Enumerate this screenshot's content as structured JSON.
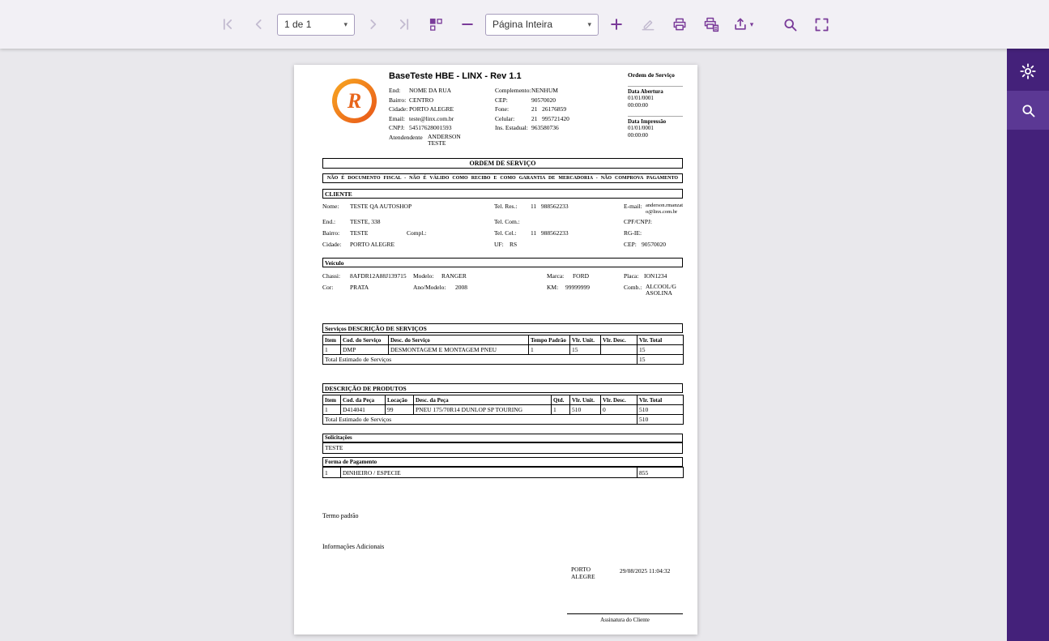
{
  "toolbar": {
    "page_select": "1 de 1",
    "zoom_select": "Página Inteira"
  },
  "icons": {
    "toolbar": [
      "first-page",
      "previous-page",
      "next-page",
      "last-page",
      "page-layout",
      "zoom-out",
      "zoom-in",
      "edit",
      "print",
      "print-setup",
      "export",
      "search",
      "fullscreen"
    ],
    "sidebar": [
      "settings",
      "search"
    ]
  },
  "doc": {
    "header": {
      "title": "BaseTeste HBE - LINX - Rev 1.1",
      "logo_letter": "R",
      "company": {
        "end_l": "End:",
        "end_v": "NOME DA RUA",
        "comp_l": "Complemento:",
        "comp_v": "NENHUM",
        "bairro_l": "Bairro:",
        "bairro_v": "CENTRO",
        "cep_l": "CEP:",
        "cep_v": "90570020",
        "cidade_l": "Cidade:",
        "cidade_v": "PORTO ALEGRE",
        "fone_l": "Fone:",
        "fone_v": "21   26176859",
        "email_l": "Email:",
        "email_v": "teste@linx.com.br",
        "cel_l": "Celular:",
        "cel_v": "21   995721420",
        "cnpj_l": "CNPJ:",
        "cnpj_v": "54517628001593",
        "ins_l": "Ins. Estadual:",
        "ins_v": "963580736",
        "atend_l": "Atendendente",
        "atend_v": "ANDERSON TESTE"
      },
      "order_label": "Ordem de Serviço",
      "abertura_l": "Data Abertura",
      "abertura_date": "01/01/0001",
      "abertura_time": "00:00:00",
      "impressao_l": "Data Impressão",
      "impressao_date": "01/01/0001",
      "impressao_time": "00:00:00"
    },
    "order_title": "ORDEM DE SERVIÇO",
    "disclaimer": "NÃO É DOCUMENTO FISCAL - NÃO É VÁLIDO COMO RECIBO E COMO GARANTIA DE MERCADORIA - NÃO COMPROVA PAGAMENTO",
    "cliente": {
      "title": "CLIENTE",
      "nome_l": "Nome:",
      "nome_v": "TESTE QA AUTOSHOP",
      "telres_l": "Tel. Res.:",
      "telres_v": "11   988562233",
      "email_l": "E-mail:",
      "email_v": "anderson.rmanzato@linx.com.br",
      "end_l": "End.:",
      "end_v": "TESTE, 338",
      "telcom_l": "Tel. Com.:",
      "cpf_l": "CPF/CNPJ:",
      "bairro_l": "Bairro:",
      "bairro_v": "TESTE",
      "compl_l": "Compl.:",
      "telcel_l": "Tel. Cel.:",
      "telcel_v": "11   988562233",
      "rgie_l": "RG-IE:",
      "cidade_l": "Cidade:",
      "cidade_v": "PORTO ALEGRE",
      "uf_l": "UF:",
      "uf_v": "RS",
      "cep_l": "CEP:",
      "cep_v": "90570020"
    },
    "veiculo": {
      "title": "Veículo",
      "chassi_l": "Chassi:",
      "chassi_v": "8AFDR12A88J139715",
      "modelo_l": "Modelo:",
      "modelo_v": "RANGER",
      "marca_l": "Marca:",
      "marca_v": "FORD",
      "placa_l": "Placa:",
      "placa_v": "ION1234",
      "cor_l": "Cor:",
      "cor_v": "PRATA",
      "ano_l": "Ano/Modelo:",
      "ano_v": "2008",
      "km_l": "KM:",
      "km_v": "99999999",
      "comb_l": "Comb.:",
      "comb_v": "ALCOOL/GASOLINA"
    },
    "services": {
      "title": "Serviços DESCRIÇÃO DE SERVIÇOS",
      "headers": [
        "Item",
        "Cod. do Serviço",
        "Desc. do Serviço",
        "Tempo Padrão",
        "Vlr. Unit.",
        "Vlr. Desc.",
        "Vlr. Total"
      ],
      "row": [
        "1",
        "DMP",
        "DESMONTAGEM E MONTAGEM PNEU",
        "1",
        "15",
        "",
        "15"
      ],
      "footer_label": "Total Estimado de Serviços",
      "footer_value": "15"
    },
    "products": {
      "title": "DESCRIÇÃO DE PRODUTOS",
      "headers": [
        "Item",
        "Cod. da Peça",
        "Locação",
        "Desc. da Peça",
        "Qtd.",
        "Vlr. Unit.",
        "Vlr. Desc.",
        "Vlr. Total"
      ],
      "row": [
        "1",
        "D414041",
        "99",
        "PNEU 175/70R14 DUNLOP SP TOURING",
        "1",
        "510",
        "0",
        "510"
      ],
      "footer_label": "Total Estimado de Serviços",
      "footer_value": "510"
    },
    "solicitacoes": {
      "title": "Solicitações",
      "value": "TESTE"
    },
    "pagamento": {
      "title": "Forma de Pagamento",
      "row": [
        "1",
        "DINHEIRO / ESPECIE",
        "855"
      ]
    },
    "footer": {
      "termo": "Termo padrão",
      "info": "Informações Adicionais",
      "city": "PORTO ALEGRE",
      "datetime": "29/08/2025 11:04:32",
      "signature": "Assinatura do Cliente"
    }
  }
}
